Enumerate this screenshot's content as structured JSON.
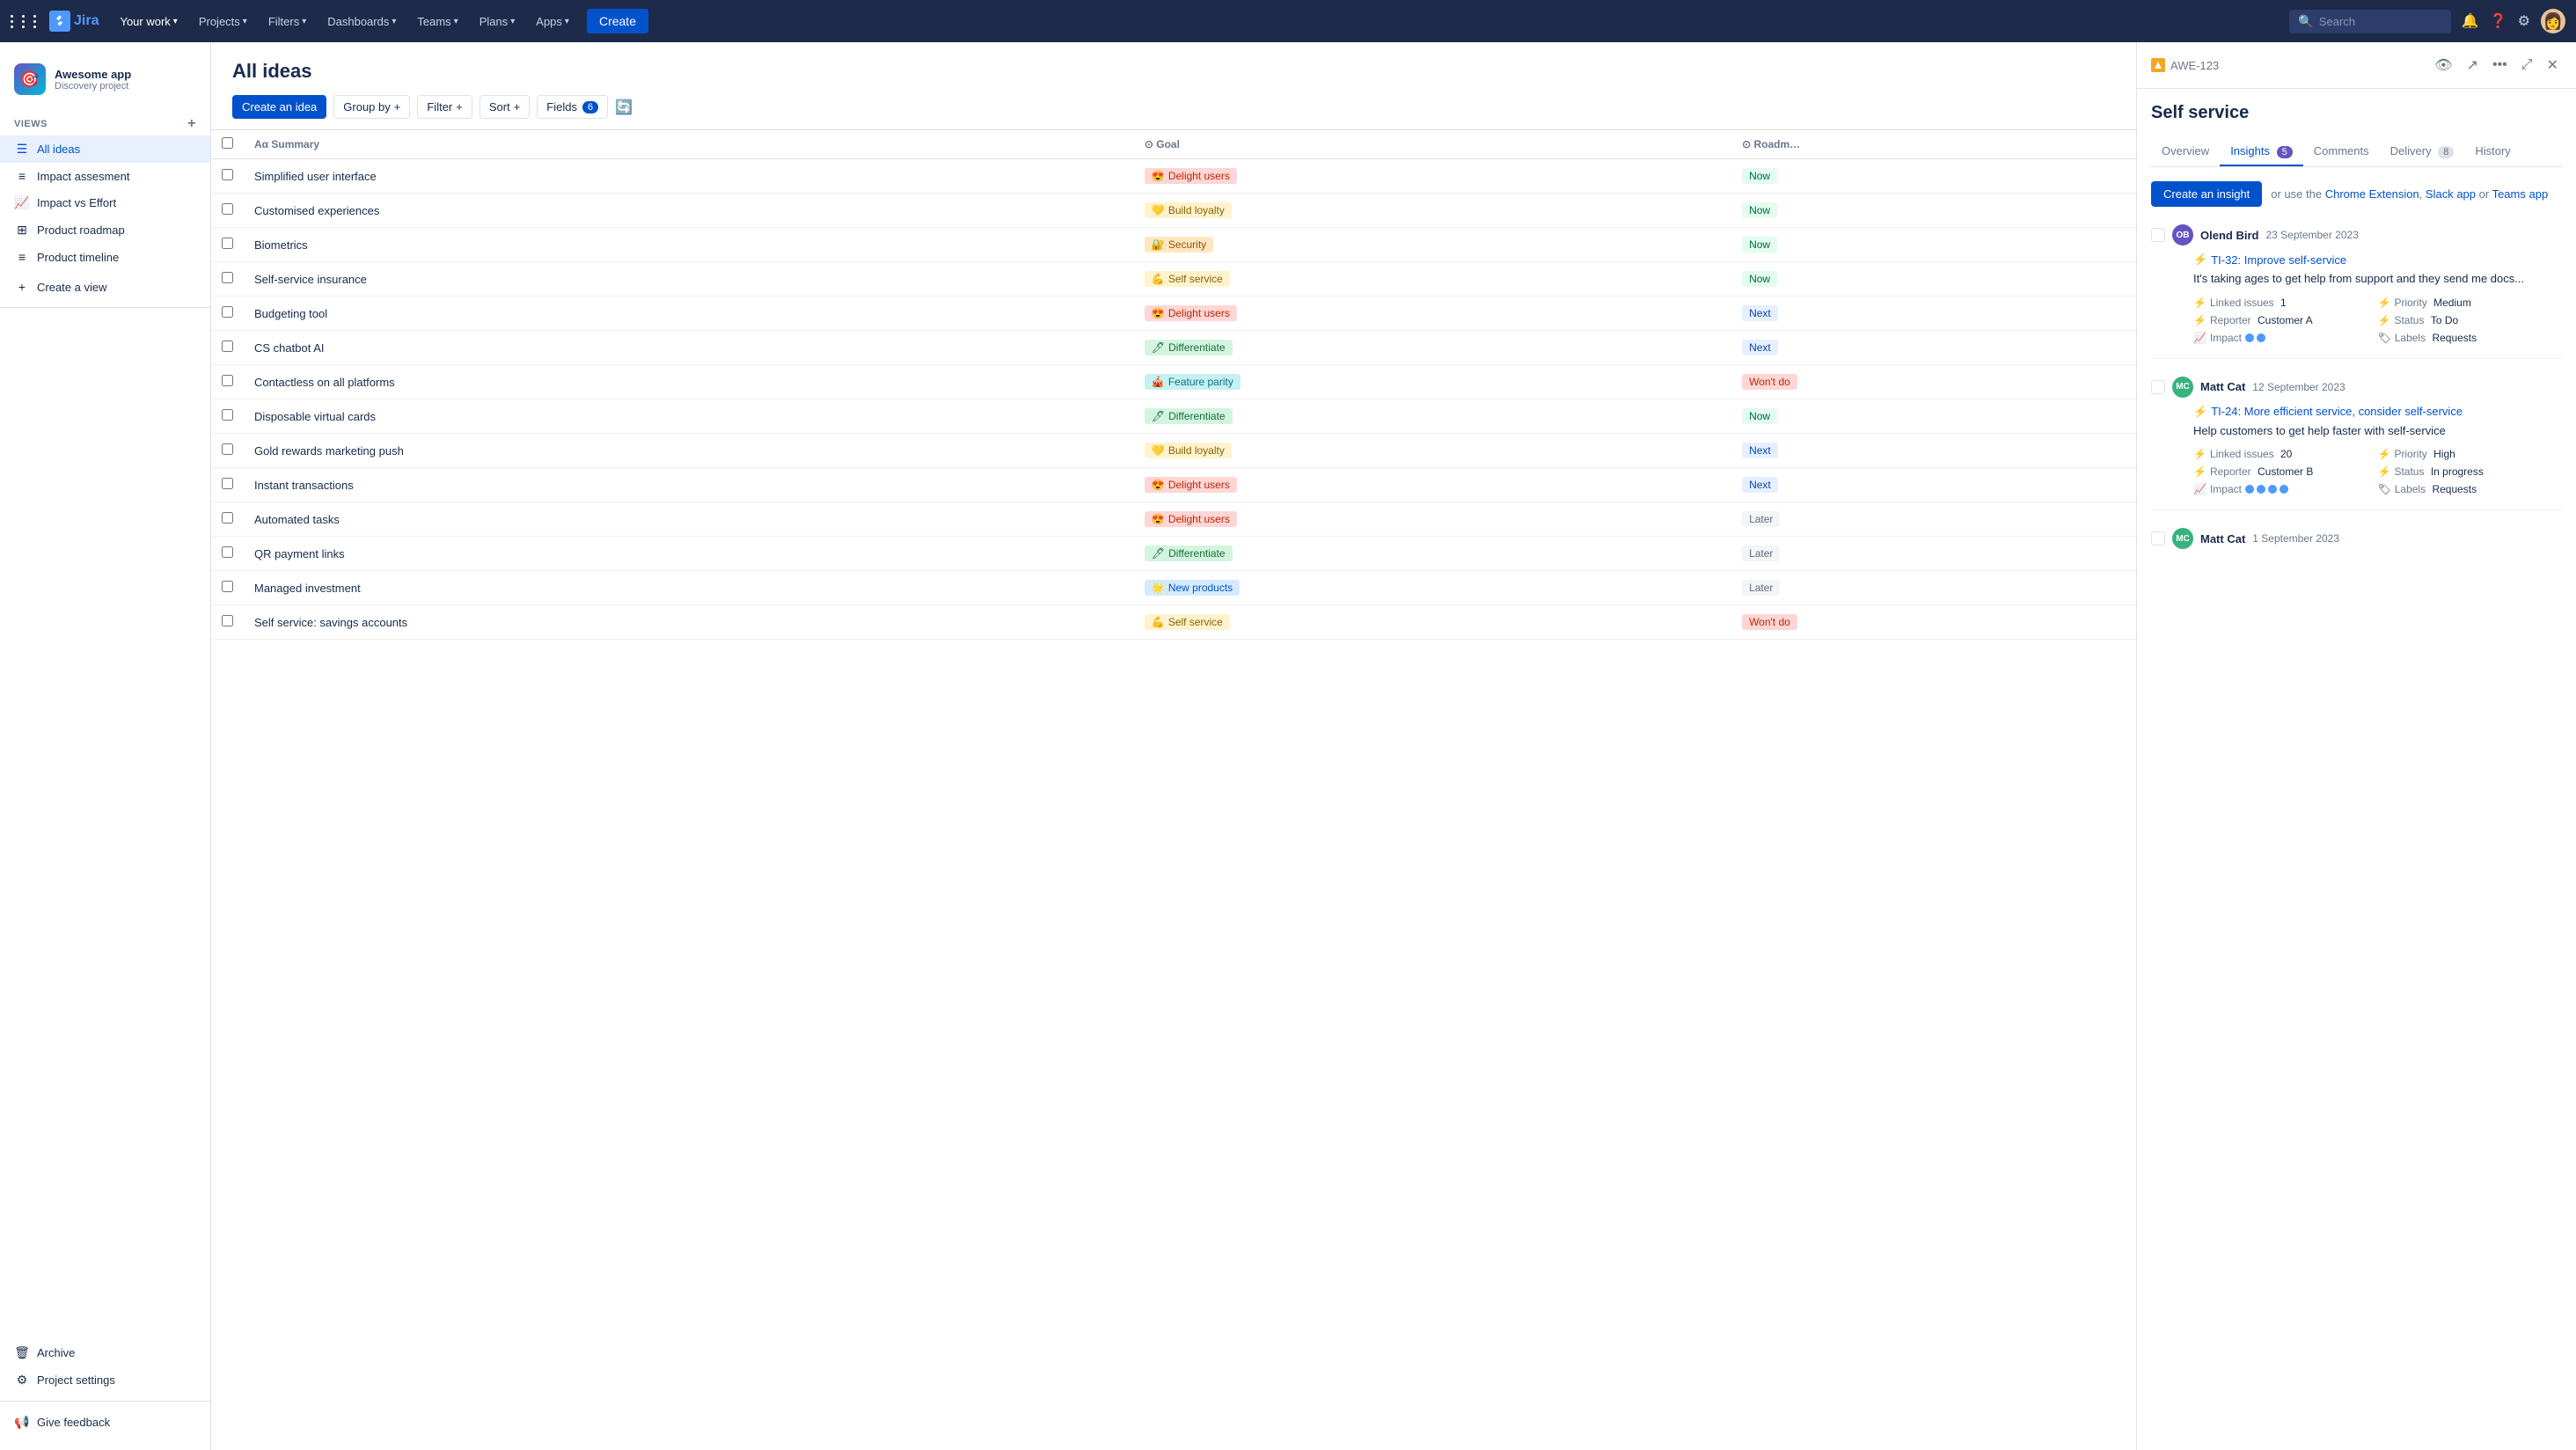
{
  "topnav": {
    "your_work": "Your work",
    "projects": "Projects",
    "filters": "Filters",
    "dashboards": "Dashboards",
    "teams": "Teams",
    "plans": "Plans",
    "apps": "Apps",
    "create": "Create",
    "search_placeholder": "Search"
  },
  "sidebar": {
    "project_name": "Awesome app",
    "project_type": "Discovery project",
    "views_label": "VIEWS",
    "items": [
      {
        "id": "all-ideas",
        "label": "All ideas",
        "icon": "☰",
        "active": true
      },
      {
        "id": "impact-assessment",
        "label": "Impact assesment",
        "icon": "≡"
      },
      {
        "id": "impact-vs-effort",
        "label": "Impact vs Effort",
        "icon": "📈"
      },
      {
        "id": "product-roadmap",
        "label": "Product roadmap",
        "icon": "⊞"
      },
      {
        "id": "product-timeline",
        "label": "Product timeline",
        "icon": "≡"
      }
    ],
    "create_view": "Create a view",
    "archive": "Archive",
    "project_settings": "Project settings",
    "give_feedback": "Give feedback"
  },
  "ideas": {
    "title": "All ideas",
    "toolbar": {
      "create_idea": "Create an idea",
      "group_by": "Group by",
      "filter": "Filter",
      "sort": "Sort",
      "fields": "Fields",
      "fields_count": "6"
    },
    "columns": [
      "",
      "Summary",
      "Goal",
      "Roadmap"
    ],
    "rows": [
      {
        "summary": "Simplified user interface",
        "goal_label": "Delight users",
        "goal_class": "chip-pink",
        "goal_emoji": "😍",
        "roadmap": "Now",
        "roadmap_class": "badge-now"
      },
      {
        "summary": "Customised experiences",
        "goal_label": "Build loyalty",
        "goal_class": "chip-yellow",
        "goal_emoji": "💛",
        "roadmap": "Now",
        "roadmap_class": "badge-now"
      },
      {
        "summary": "Biometrics",
        "goal_label": "Security",
        "goal_class": "chip-orange",
        "goal_emoji": "🔐",
        "roadmap": "Now",
        "roadmap_class": "badge-now"
      },
      {
        "summary": "Self-service insurance",
        "goal_label": "Self service",
        "goal_class": "chip-yellow",
        "goal_emoji": "💪",
        "roadmap": "Now",
        "roadmap_class": "badge-now"
      },
      {
        "summary": "Budgeting tool",
        "goal_label": "Delight users",
        "goal_class": "chip-pink",
        "goal_emoji": "😍",
        "roadmap": "Next",
        "roadmap_class": "badge-next"
      },
      {
        "summary": "CS chatbot AI",
        "goal_label": "Differentiate",
        "goal_class": "chip-green",
        "goal_emoji": "🖊",
        "roadmap": "Next",
        "roadmap_class": "badge-next"
      },
      {
        "summary": "Contactless on all platforms",
        "goal_label": "Feature parity",
        "goal_class": "chip-teal",
        "goal_emoji": "🎪",
        "roadmap": "Won't do",
        "roadmap_class": "badge-wontdo"
      },
      {
        "summary": "Disposable virtual cards",
        "goal_label": "Differentiate",
        "goal_class": "chip-green",
        "goal_emoji": "🖊",
        "roadmap": "Now",
        "roadmap_class": "badge-now"
      },
      {
        "summary": "Gold rewards marketing push",
        "goal_label": "Build loyalty",
        "goal_class": "chip-yellow",
        "goal_emoji": "💛",
        "roadmap": "Next",
        "roadmap_class": "badge-next"
      },
      {
        "summary": "Instant transactions",
        "goal_label": "Delight users",
        "goal_class": "chip-pink",
        "goal_emoji": "😍",
        "roadmap": "Next",
        "roadmap_class": "badge-next"
      },
      {
        "summary": "Automated tasks",
        "goal_label": "Delight users",
        "goal_class": "chip-pink",
        "goal_emoji": "😍",
        "roadmap": "Later",
        "roadmap_class": "badge-later"
      },
      {
        "summary": "QR payment links",
        "goal_label": "Differentiate",
        "goal_class": "chip-green",
        "goal_emoji": "🖊",
        "roadmap": "Later",
        "roadmap_class": "badge-later"
      },
      {
        "summary": "Managed investment",
        "goal_label": "New products",
        "goal_class": "chip-blue",
        "goal_emoji": "🌟",
        "roadmap": "Later",
        "roadmap_class": "badge-later"
      },
      {
        "summary": "Self service: savings accounts",
        "goal_label": "Self service",
        "goal_class": "chip-yellow",
        "goal_emoji": "💪",
        "roadmap": "Won't do",
        "roadmap_class": "badge-wontdo"
      }
    ]
  },
  "detail": {
    "issue_id": "AWE-123",
    "title": "Self service",
    "tabs": [
      {
        "id": "overview",
        "label": "Overview",
        "badge": null,
        "badge_type": null
      },
      {
        "id": "insights",
        "label": "Insights",
        "badge": "5",
        "badge_type": "purple"
      },
      {
        "id": "comments",
        "label": "Comments",
        "badge": null,
        "badge_type": null
      },
      {
        "id": "delivery",
        "label": "Delivery",
        "badge": "8",
        "badge_type": "gray"
      },
      {
        "id": "history",
        "label": "History",
        "badge": null,
        "badge_type": null
      }
    ],
    "active_tab": "insights",
    "create_insight_btn": "Create an insight",
    "or_use_text": "or use the",
    "chrome_ext": "Chrome Extension",
    "slack_app": "Slack app",
    "teams_app": "Teams app",
    "insights": [
      {
        "author_name": "Olend Bird",
        "author_initials": "OB",
        "author_color": "#6554c0",
        "date": "23 September 2023",
        "link_id": "TI-32",
        "link_text": "TI-32: Improve self-service",
        "description": "It's taking ages to get help from support and they send me docs...",
        "linked_issues_label": "Linked issues",
        "linked_issues_value": "1",
        "priority_label": "Priority",
        "priority_value": "Medium",
        "reporter_label": "Reporter",
        "reporter_value": "Customer A",
        "status_label": "Status",
        "status_value": "To Do",
        "impact_label": "Impact",
        "impact_dots": 2,
        "labels_label": "Labels",
        "labels_value": "Requests"
      },
      {
        "author_name": "Matt Cat",
        "author_initials": "MC",
        "author_color": "#36b37e",
        "date": "12 September 2023",
        "link_id": "TI-24",
        "link_text": "TI-24: More efficient service, consider self-service",
        "description": "Help customers to get help faster with self-service",
        "linked_issues_label": "Linked issues",
        "linked_issues_value": "20",
        "priority_label": "Priority",
        "priority_value": "High",
        "reporter_label": "Reporter",
        "reporter_value": "Customer B",
        "status_label": "Status",
        "status_value": "In progress",
        "impact_label": "Impact",
        "impact_dots": 4,
        "labels_label": "Labels",
        "labels_value": "Requests"
      },
      {
        "author_name": "Matt Cat",
        "author_initials": "MC",
        "author_color": "#36b37e",
        "date": "1 September 2023",
        "link_id": "",
        "link_text": "",
        "description": "",
        "linked_issues_label": "",
        "linked_issues_value": "",
        "priority_label": "",
        "priority_value": "",
        "reporter_label": "",
        "reporter_value": "",
        "status_label": "",
        "status_value": "",
        "impact_label": "",
        "impact_dots": 0,
        "labels_label": "",
        "labels_value": ""
      }
    ]
  }
}
